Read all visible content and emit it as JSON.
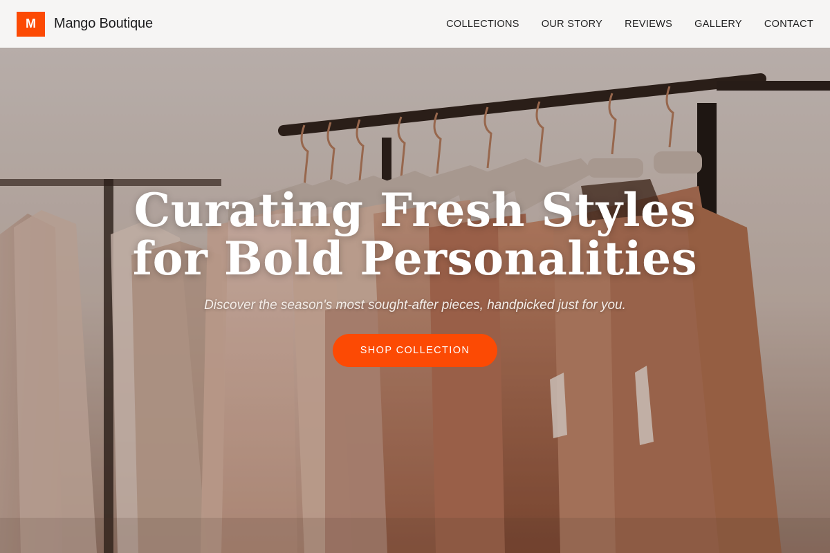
{
  "brand": {
    "logo_letter": "M",
    "name": "Mango Boutique"
  },
  "nav": {
    "items": [
      {
        "label": "COLLECTIONS"
      },
      {
        "label": "OUR STORY"
      },
      {
        "label": "REVIEWS"
      },
      {
        "label": "GALLERY"
      },
      {
        "label": "CONTACT"
      }
    ]
  },
  "hero": {
    "title": "Curating Fresh Styles for Bold Personalities",
    "subtitle": "Discover the season's most sought-after pieces, handpicked just for you.",
    "cta_label": "SHOP COLLECTION",
    "background_description_icon": "clothing-rack-photo"
  },
  "colors": {
    "accent": "#fc4a04",
    "header_bg": "#f6f5f4",
    "nav_text": "#222222",
    "hero_text": "#ffffff"
  }
}
